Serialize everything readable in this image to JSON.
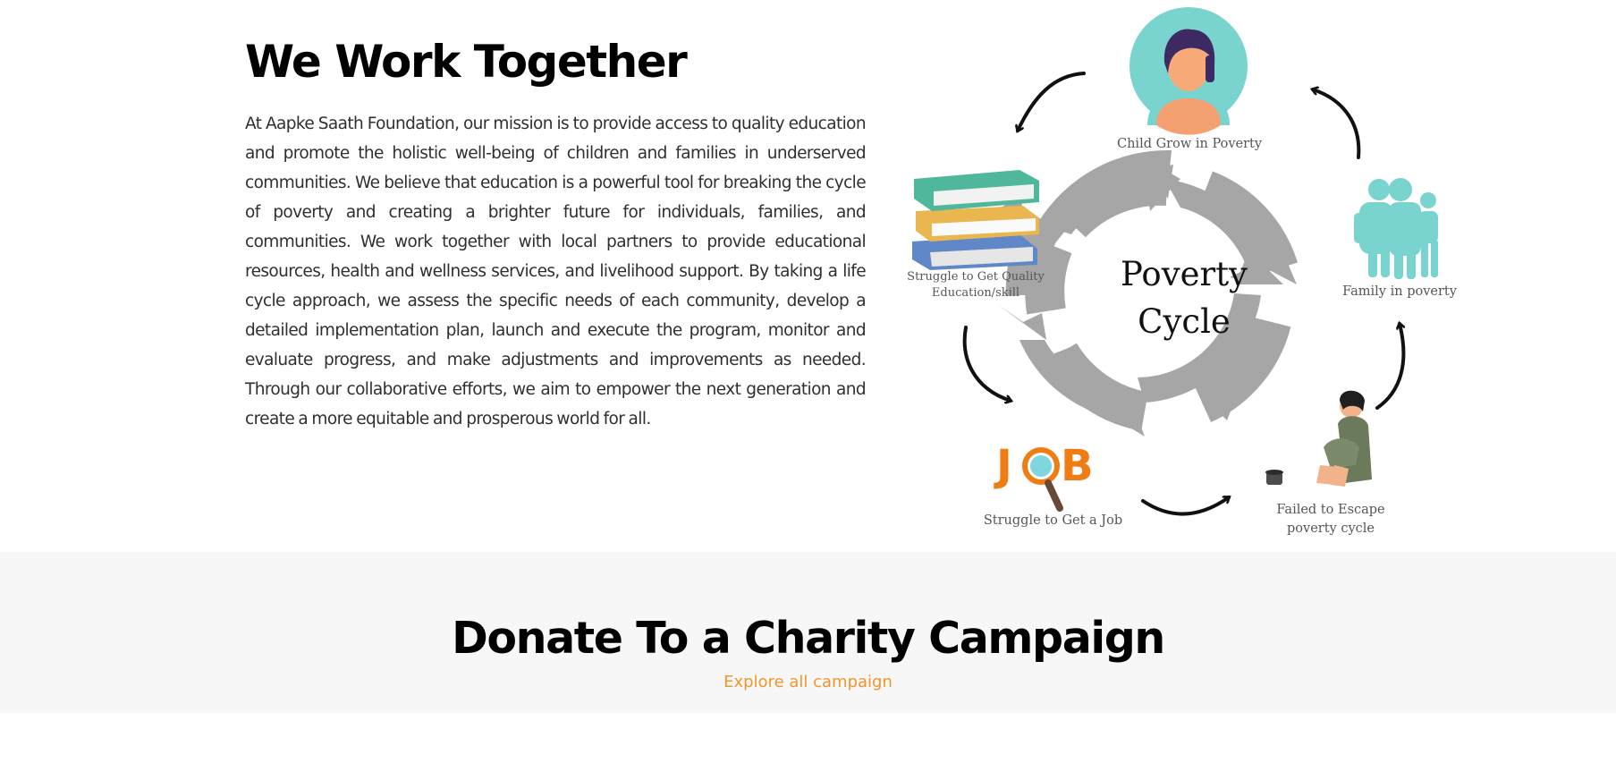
{
  "about": {
    "title": "We Work Together",
    "paragraph": "At Aapke Saath Foundation, our mission is to provide access to quality education and promote the holistic well-being of children and families in underserved communities. We believe that education is a powerful tool for breaking the cycle of poverty and creating a brighter future for individuals, families, and communities. We work together with local partners to provide educational resources, health and wellness services, and livelihood support. By taking a life cycle approach, we assess the specific needs of each community, develop a detailed implementation plan, launch and execute the program, monitor and evaluate progress, and make adjustments and improvements as needed. Through our collaborative efforts, we aim to empower the next generation and create a more equitable and prosperous world for all."
  },
  "diagram": {
    "center": "Poverty\nCycle",
    "labels": {
      "child": "Child Grow in Poverty",
      "family": "Family in poverty",
      "escape": "Failed to Escape\npoverty cycle",
      "job": "Struggle to Get a Job",
      "education": "Struggle to Get Quality\nEducation/skill"
    },
    "job_logo": {
      "left": "J",
      "right": "B"
    },
    "colors": {
      "teal": "#79d3cf",
      "grey_arrows": "#a6a6a6",
      "job_orange": "#f07c14"
    }
  },
  "donate": {
    "title": "Donate To a Charity Campaign",
    "link": "Explore all campaign"
  },
  "colors": {
    "accent": "#f0962c",
    "band": "#f7f7f7"
  }
}
